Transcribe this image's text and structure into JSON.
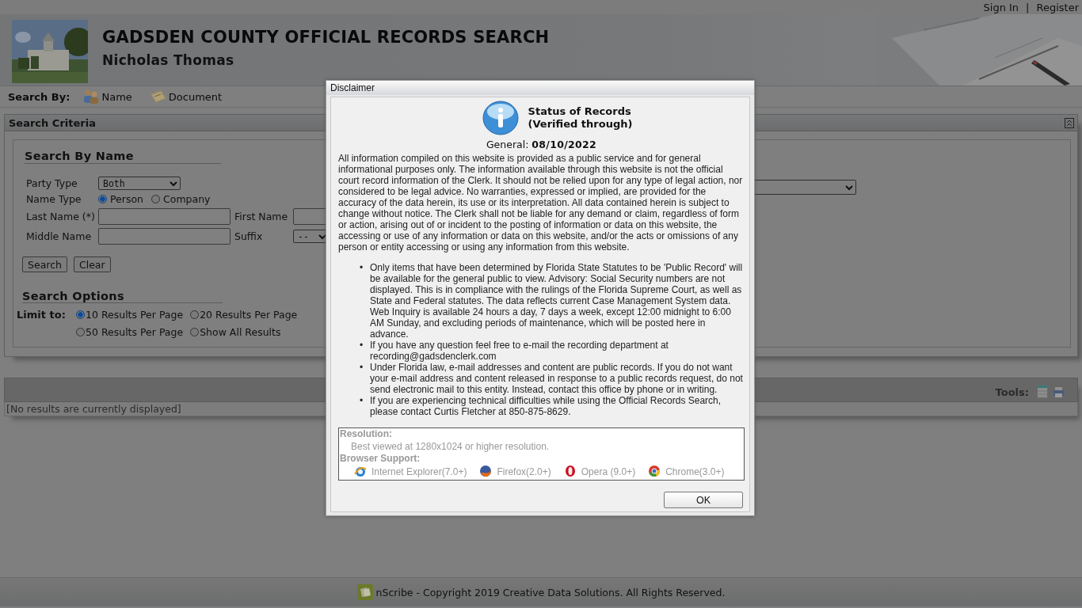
{
  "top_links": {
    "items": [
      {
        "label": "Sign In"
      },
      {
        "label": "Register"
      }
    ],
    "separator": "|"
  },
  "header": {
    "title": "GADSDEN COUNTY OFFICIAL RECORDS SEARCH",
    "subtitle": "Nicholas Thomas"
  },
  "search_by": {
    "label": "Search By:",
    "options": [
      {
        "kind": "people",
        "label": "Name"
      },
      {
        "kind": "document",
        "label": "Document"
      }
    ]
  },
  "search_criteria": {
    "title": "Search Criteria",
    "section_title": "Search By Name",
    "party_type": {
      "label": "Party Type",
      "value": "Both"
    },
    "name_type": {
      "label": "Name Type",
      "options": [
        {
          "label": "Person",
          "selected": true
        },
        {
          "label": "Company",
          "selected": false
        }
      ]
    },
    "last_name": {
      "label": "Last Name (*)"
    },
    "first_name": {
      "label": "First Name"
    },
    "middle_name": {
      "label": "Middle Name"
    },
    "suffix": {
      "label": "Suffix",
      "value": "--"
    },
    "buttons": [
      "Search",
      "Clear"
    ],
    "options_title": "Search Options",
    "limit": {
      "label": "Limit to:",
      "options": [
        {
          "label": "10 Results Per Page",
          "selected": true
        },
        {
          "label": "20 Results Per Page",
          "selected": false
        },
        {
          "label": "50 Results Per Page",
          "selected": false
        },
        {
          "label": "Show All Results",
          "selected": false
        }
      ]
    }
  },
  "results": {
    "tools_label": "Tools:",
    "empty_message": "[No results are currently displayed]"
  },
  "footer": {
    "text": "nScribe - Copyright 2019 Creative Data Solutions. All Rights Reserved."
  },
  "dialog": {
    "title": "Disclaimer",
    "status_lines": [
      "Status of Records",
      "(Verified through)"
    ],
    "general_label": "General:",
    "general_date": "08/10/2022",
    "paragraph": "All information compiled on this website is provided as a public service and for general informational purposes only. The information available through this website is not the official court record information of the Clerk. It should not be relied upon for any type of legal action, nor considered to be legal advice. No warranties, expressed or implied, are provided for the accuracy of the data herein, its use or its interpretation. All data contained herein is subject to change without notice. The Clerk shall not be liable for any demand or claim, regardless of form or action, arising out of or incident to the posting of information or data on this website, the accessing or use of any information or data on this website, and/or the acts or omissions of any person or entity accessing or using any information from this website.",
    "bullets": [
      "Only items that have been determined by Florida State Statutes to be 'Public Record' will be available for the general public to view. Advisory: Social Security numbers are not displayed. This is in compliance with the rulings of the Florida Supreme Court, as well as State and Federal statutes. The data reflects current Case Management System data. Web Inquiry is available 24 hours a day, 7 days a week, except 12:00 midnight to 6:00 AM Sunday, and excluding periods of maintenance, which will be posted here in advance.",
      "If you have any question feel free to e-mail the recording department at recording@gadsdenclerk.com",
      "Under Florida law, e-mail addresses and content are public records. If you do not want your e-mail address and content released in response to a public records request, do not send electronic mail to this entity. Instead, contact this office by phone or in writing.",
      "If you are experiencing technical difficulties while using the Official Records Search, please contact Curtis Fletcher at 850-875-8629."
    ],
    "bullet_marker": "•",
    "resolution_label": "Resolution:",
    "resolution_text": "Best viewed at 1280x1024 or higher resolution.",
    "browser_label": "Browser Support:",
    "browsers": [
      {
        "kind": "ie",
        "label": "Internet Explorer(7.0+)"
      },
      {
        "kind": "firefox",
        "label": "Firefox(2.0+)"
      },
      {
        "kind": "opera",
        "label": "Opera (9.0+)"
      },
      {
        "kind": "chrome",
        "label": "Chrome(3.0+)"
      }
    ],
    "button": "OK"
  }
}
